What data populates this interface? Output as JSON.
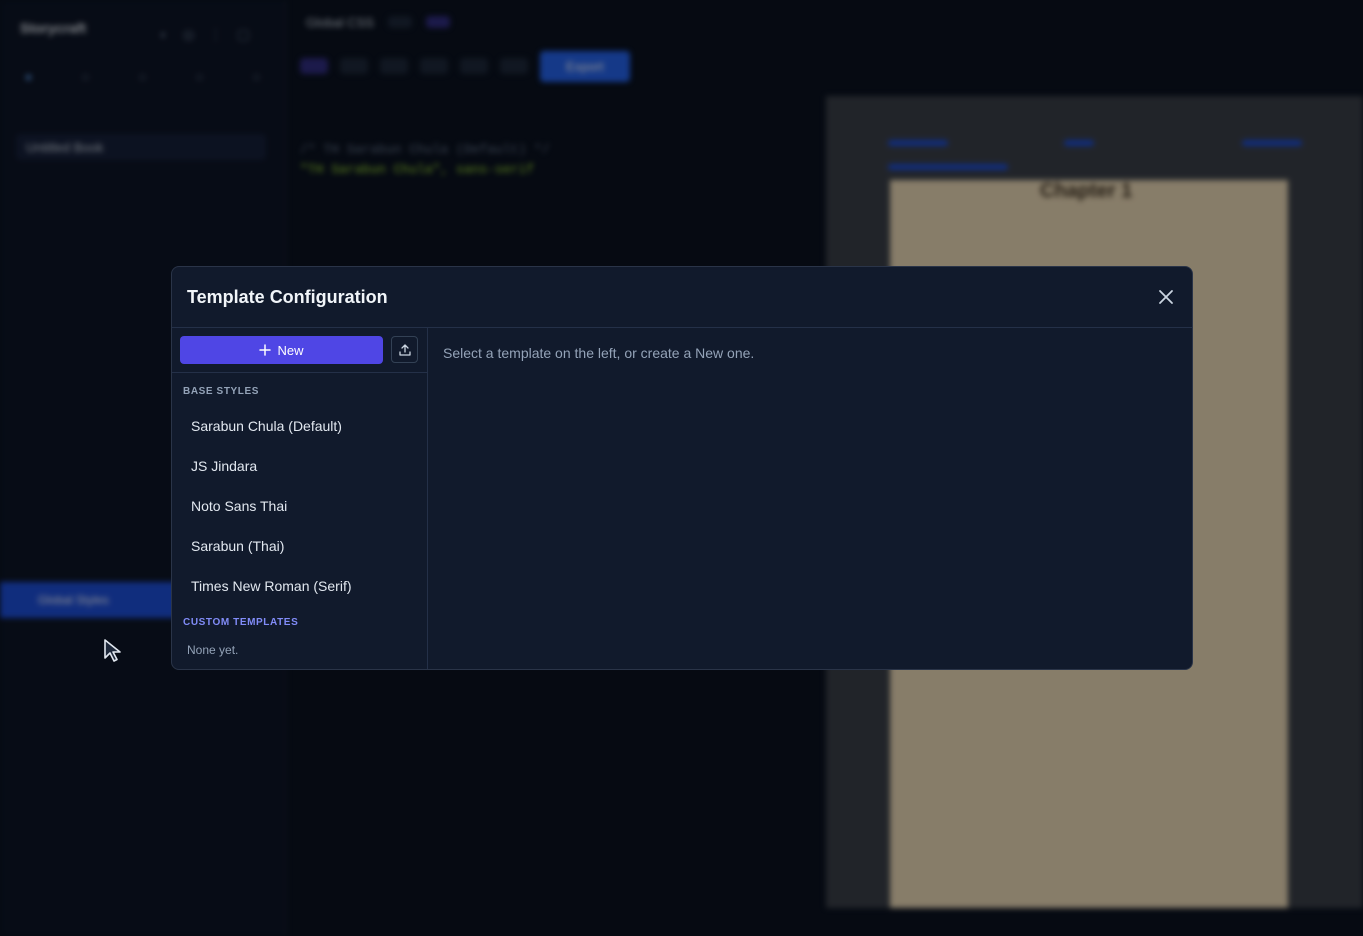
{
  "modal": {
    "title": "Template Configuration",
    "new_button_label": "New",
    "base_styles_label": "BASE STYLES",
    "base_styles": [
      "Sarabun Chula (Default)",
      "JS Jindara",
      "Noto Sans Thai",
      "Sarabun (Thai)",
      "Times New Roman (Serif)"
    ],
    "custom_templates_label": "CUSTOM TEMPLATES",
    "custom_templates_empty": "None yet.",
    "hint": "Select a template on the left, or create a New one."
  },
  "background": {
    "app_name": "Storycraft",
    "tab_title": "Global CSS",
    "book_title": "Untitled Book",
    "chapter_title": "Chapter 1",
    "editor_comment": "/* TH Sarabun Chula (Default) */",
    "editor_font": "\"TH Sarabun Chula\", sans-serif",
    "export_label": "Export",
    "sidebar_active_item": "Global Styles"
  },
  "colors": {
    "accent": "#4f46e5",
    "modal_bg": "#111a2c",
    "custom_label": "#818cf8"
  },
  "icons": {
    "close": "close-icon",
    "plus": "plus-icon",
    "import": "upload-icon",
    "cursor": "mouse-pointer-icon"
  }
}
